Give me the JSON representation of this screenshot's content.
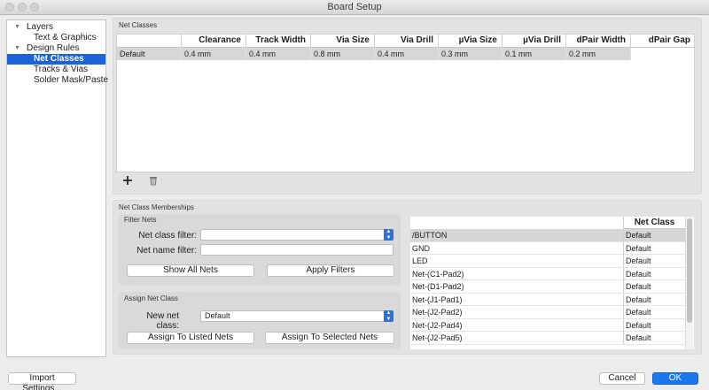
{
  "window": {
    "title": "Board Setup"
  },
  "tree": {
    "items": [
      {
        "label": "Layers",
        "has_disclosure": true
      },
      {
        "label": "Text & Graphics"
      },
      {
        "label": "Design Rules",
        "has_disclosure": true
      },
      {
        "label": "Net Classes",
        "selected": true
      },
      {
        "label": "Tracks & Vias"
      },
      {
        "label": "Solder Mask/Paste"
      }
    ]
  },
  "net_classes": {
    "title": "Net Classes",
    "columns": [
      "Clearance",
      "Track Width",
      "Via Size",
      "Via Drill",
      "µVia Size",
      "µVia Drill",
      "dPair Width",
      "dPair Gap"
    ],
    "rows": [
      {
        "name": "Default",
        "values": [
          "0.4 mm",
          "0.4 mm",
          "0.8 mm",
          "0.4 mm",
          "0.3 mm",
          "0.1 mm",
          "0.2 mm",
          ""
        ]
      }
    ],
    "add_icon": "plus-icon",
    "delete_icon": "trash-icon"
  },
  "memberships": {
    "title": "Net Class Memberships",
    "filter": {
      "title": "Filter Nets",
      "class_filter_label": "Net class filter:",
      "class_filter_value": "",
      "name_filter_label": "Net name filter:",
      "name_filter_value": "",
      "show_all_label": "Show All Nets",
      "apply_label": "Apply Filters"
    },
    "assign": {
      "title": "Assign Net Class",
      "new_class_label": "New net class:",
      "new_class_value": "Default",
      "assign_listed_label": "Assign To Listed Nets",
      "assign_selected_label": "Assign To Selected Nets"
    },
    "table": {
      "header": "Net Class",
      "rows": [
        {
          "net": "/BUTTON",
          "class": "Default",
          "selected": true
        },
        {
          "net": "GND",
          "class": "Default"
        },
        {
          "net": "LED",
          "class": "Default"
        },
        {
          "net": "Net-(C1-Pad2)",
          "class": "Default"
        },
        {
          "net": "Net-(D1-Pad2)",
          "class": "Default"
        },
        {
          "net": "Net-(J1-Pad1)",
          "class": "Default"
        },
        {
          "net": "Net-(J2-Pad2)",
          "class": "Default"
        },
        {
          "net": "Net-(J2-Pad4)",
          "class": "Default"
        },
        {
          "net": "Net-(J2-Pad5)",
          "class": "Default"
        }
      ]
    }
  },
  "footer": {
    "import_label": "Import Settings...",
    "cancel_label": "Cancel",
    "ok_label": "OK"
  },
  "colors": {
    "accent": "#1b63d6",
    "primary_button": "#1c77ee"
  }
}
